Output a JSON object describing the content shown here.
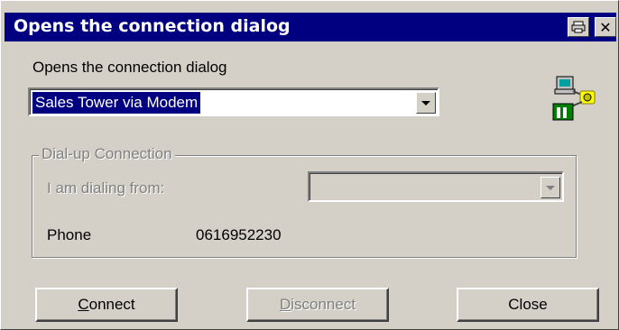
{
  "window": {
    "title": "Opens the connection dialog",
    "controls": {
      "print_icon": "printer-icon",
      "close": "✕"
    }
  },
  "prompt_label": "Opens the connection dialog",
  "connection_combo": {
    "value": "Sales Tower via Modem"
  },
  "connection_icon": "network-computers-icon",
  "dialup_group": {
    "caption": "Dial-up Connection",
    "dialing_from_label": "I am dialing from:",
    "dialing_from_value": "",
    "phone_label": "Phone",
    "phone_value": "0616952230"
  },
  "buttons": {
    "connect_first": "C",
    "connect_rest": "onnect",
    "disconnect_first": "D",
    "disconnect_rest": "isconnect",
    "close": "Close"
  },
  "colors": {
    "titlebar": "#000080",
    "face": "#d4d0c8",
    "selection": "#000080",
    "disabled_text": "#808080"
  }
}
